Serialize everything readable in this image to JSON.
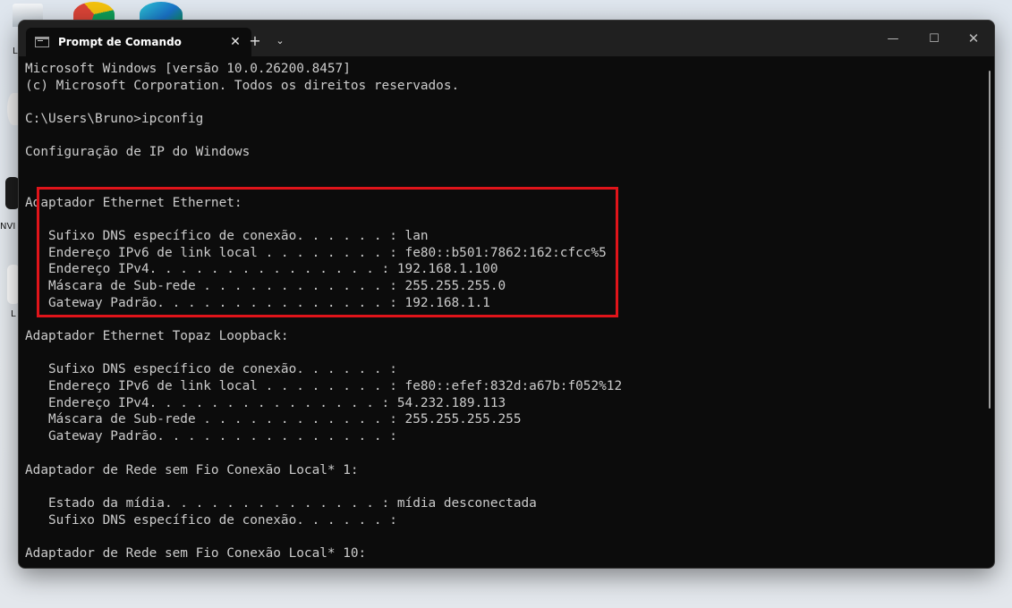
{
  "window": {
    "tab_title": "Prompt de Comando",
    "tab_close": "✕",
    "new_tab": "+",
    "dropdown": "⌄",
    "minimize": "—",
    "maximize": "☐",
    "close": "✕"
  },
  "desktop": {
    "labels": [
      "L",
      "NVI",
      "L"
    ]
  },
  "terminal": {
    "lines": [
      "Microsoft Windows [versão 10.0.26200.8457]",
      "(c) Microsoft Corporation. Todos os direitos reservados.",
      "",
      "C:\\Users\\Bruno>ipconfig",
      "",
      "Configuração de IP do Windows",
      "",
      "",
      "Adaptador Ethernet Ethernet:",
      "",
      "   Sufixo DNS específico de conexão. . . . . . : lan",
      "   Endereço IPv6 de link local . . . . . . . . : fe80::b501:7862:162:cfcc%5",
      "   Endereço IPv4. . . . . . . . . . . . . . . : 192.168.1.100",
      "   Máscara de Sub-rede . . . . . . . . . . . . : 255.255.255.0",
      "   Gateway Padrão. . . . . . . . . . . . . . . : 192.168.1.1",
      "",
      "Adaptador Ethernet Topaz Loopback:",
      "",
      "   Sufixo DNS específico de conexão. . . . . . :",
      "   Endereço IPv6 de link local . . . . . . . . : fe80::efef:832d:a67b:f052%12",
      "   Endereço IPv4. . . . . . . . . . . . . . . : 54.232.189.113",
      "   Máscara de Sub-rede . . . . . . . . . . . . : 255.255.255.255",
      "   Gateway Padrão. . . . . . . . . . . . . . . :",
      "",
      "Adaptador de Rede sem Fio Conexão Local* 1:",
      "",
      "   Estado da mídia. . . . . . . . . . . . . . : mídia desconectada",
      "   Sufixo DNS específico de conexão. . . . . . :",
      "",
      "Adaptador de Rede sem Fio Conexão Local* 10:"
    ]
  },
  "colors": {
    "terminal_bg": "#0c0c0c",
    "terminal_fg": "#cccccc",
    "titlebar_bg": "#202020",
    "highlight": "#e0141a"
  }
}
